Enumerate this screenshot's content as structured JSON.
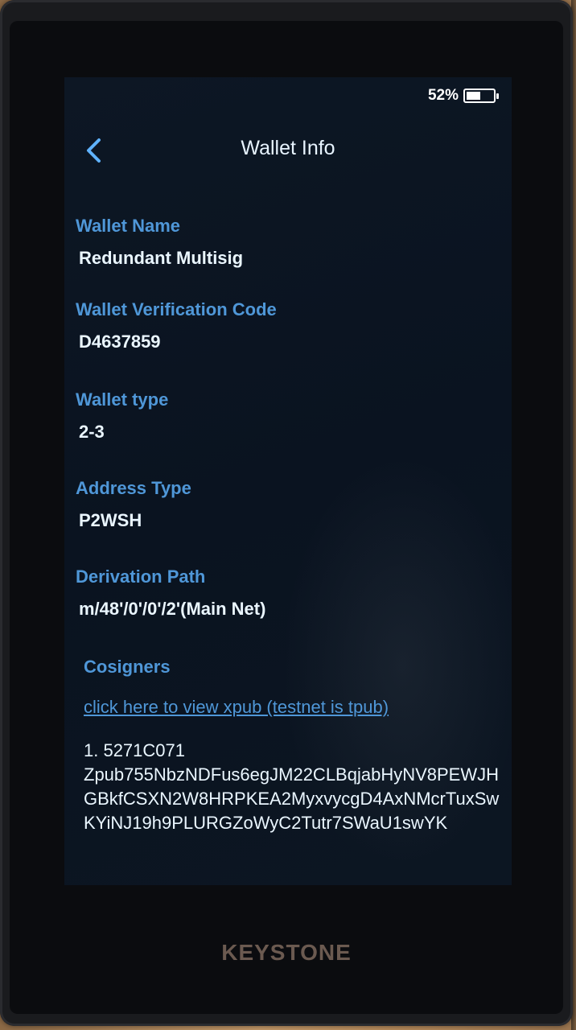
{
  "status": {
    "battery_percent_label": "52%",
    "battery_level": 0.52
  },
  "nav": {
    "title": "Wallet Info"
  },
  "fields": {
    "wallet_name": {
      "label": "Wallet Name",
      "value": "Redundant Multisig"
    },
    "verification_code": {
      "label": "Wallet Verification Code",
      "value": "D4637859"
    },
    "wallet_type": {
      "label": "Wallet type",
      "value": "2-3"
    },
    "address_type": {
      "label": "Address Type",
      "value": "P2WSH"
    },
    "derivation_path": {
      "label": "Derivation Path",
      "value": "m/48'/0'/0'/2'(Main Net)"
    },
    "cosigners": {
      "label": "Cosigners"
    }
  },
  "cosigners": {
    "xpub_link": "click here to view xpub (testnet is tpub)",
    "items": [
      {
        "index_fingerprint": "1. 5271C071",
        "xpub": "Zpub755NbzNDFus6egJM22CLBqjabHyNV8PEWJHGBkfCSXN2W8HRPKEA2MyxvycgD4AxNMcrTuxSwKYiNJ19h9PLURGZoWyC2Tutr7SWaU1swYK"
      }
    ]
  },
  "device": {
    "brand": "KEYSTONE"
  }
}
